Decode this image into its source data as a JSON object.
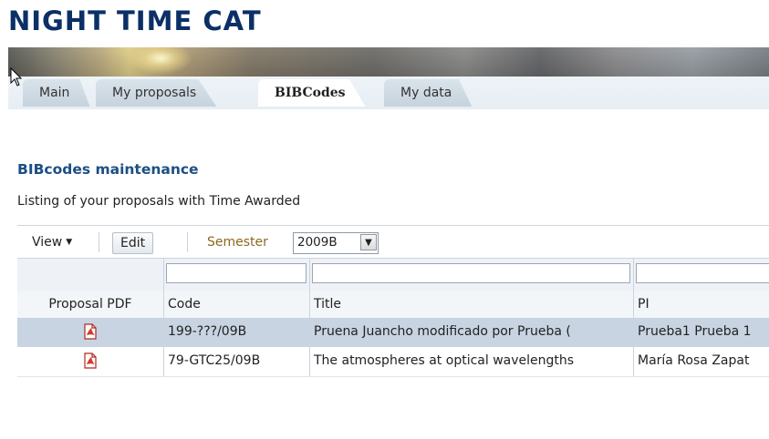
{
  "app": {
    "title": "NIGHT TIME CAT"
  },
  "tabs": [
    {
      "label": "Main"
    },
    {
      "label": "My proposals"
    },
    {
      "label": "BIBCodes"
    },
    {
      "label": "My data"
    }
  ],
  "section": {
    "title": "BIBcodes maintenance",
    "subtitle": "Listing of your proposals with Time Awarded"
  },
  "toolbar": {
    "view_label": "View",
    "edit_label": "Edit",
    "semester_label": "Semester",
    "semester_value": "2009B"
  },
  "table": {
    "columns": [
      "Proposal PDF",
      "Code",
      "Title",
      "PI"
    ],
    "rows": [
      {
        "pdf_icon": "pdf-icon",
        "code": "199-???/09B",
        "title": "Pruena Juancho modificado por Prueba (",
        "pi": "Prueba1 Prueba 1"
      },
      {
        "pdf_icon": "pdf-icon",
        "code": "79-GTC25/09B",
        "title": "The atmospheres at optical wavelengths",
        "pi": "María Rosa Zapat"
      }
    ]
  },
  "colors": {
    "title": "#0b2f66",
    "section_title": "#1c4f84",
    "selected_row": "#c8d4e2",
    "semester_label": "#8a6a1e"
  }
}
